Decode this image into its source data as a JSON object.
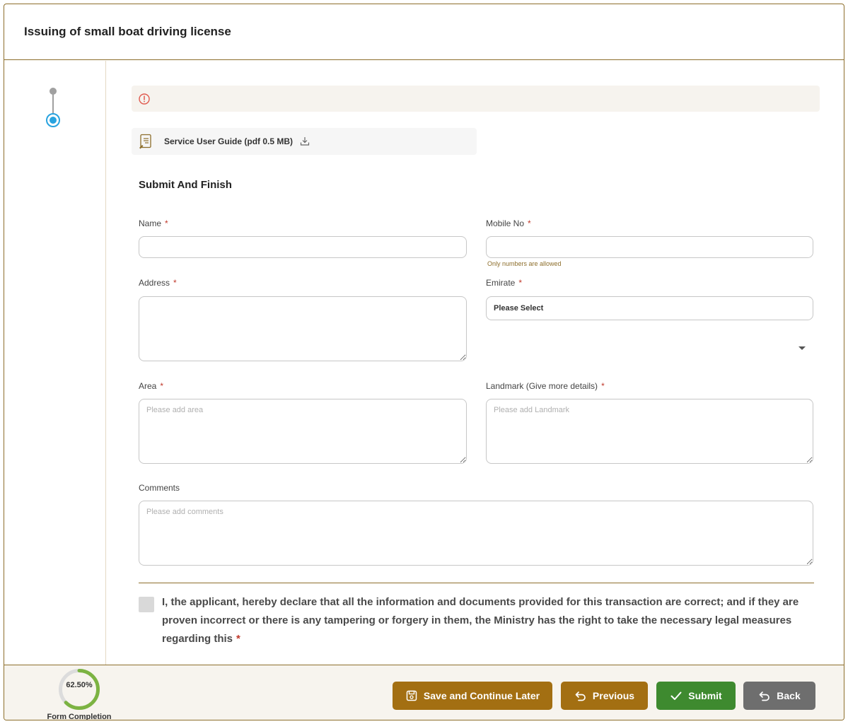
{
  "header": {
    "title": "Issuing of small boat driving license"
  },
  "guide": {
    "label": "Service User Guide (pdf 0.5 MB)"
  },
  "section": {
    "title": "Submit And Finish"
  },
  "fields": {
    "name": {
      "label": "Name",
      "value": ""
    },
    "mobile": {
      "label": "Mobile No",
      "value": "",
      "hint": "Only numbers are allowed"
    },
    "address": {
      "label": "Address",
      "value": ""
    },
    "emirate": {
      "label": "Emirate",
      "selected": "Please Select"
    },
    "area": {
      "label": "Area",
      "placeholder": "Please add area"
    },
    "landmark": {
      "label": "Landmark (Give more details)",
      "placeholder": "Please add Landmark"
    },
    "comments": {
      "label": "Comments",
      "placeholder": "Please add comments"
    }
  },
  "required_mark": "*",
  "declaration": {
    "text": "I, the applicant, hereby declare that all the information and documents provided for this transaction are correct; and if they are proven incorrect or there is any tampering or forgery in them, the Ministry has the right to take the necessary legal measures regarding this",
    "checked": false
  },
  "footer": {
    "progress_text": "62.50%",
    "progress_value": 62.5,
    "progress_caption": "Form Completion",
    "buttons": {
      "save": "Save and Continue Later",
      "previous": "Previous",
      "submit": "Submit",
      "back": "Back"
    }
  },
  "colors": {
    "brand_gold": "#a36f12",
    "border_gold": "#8d6e2b",
    "submit_green": "#3e8a2f",
    "back_gray": "#6e6e6e",
    "step_blue": "#29a3df",
    "progress_green": "#7cb342",
    "required_red": "#c0392b"
  }
}
